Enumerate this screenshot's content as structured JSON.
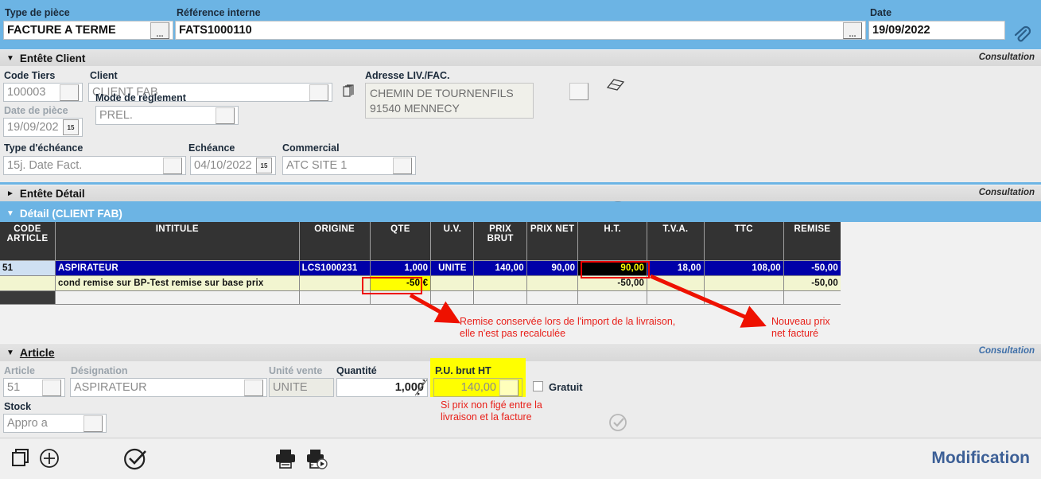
{
  "header": {
    "type_piece_label": "Type de pièce",
    "type_piece_value": "FACTURE A TERME",
    "reference_label": "Référence interne",
    "reference_value": "FATS1000110",
    "date_label": "Date",
    "date_value": "19/09/2022",
    "attach_icon": "paperclip-icon",
    "ellipsis": "..."
  },
  "entete_client": {
    "title": "Entête Client",
    "status": "Consultation",
    "code_tiers_label": "Code Tiers",
    "code_tiers_value": "100003",
    "client_label": "Client",
    "client_value": "CLIENT FAB",
    "copy_icon": "copy-pages-icon",
    "adresse_label": "Adresse LIV./FAC.",
    "adresse_line1": "CHEMIN DE TOURNENFILS",
    "adresse_line2": "91540  MENNECY",
    "map_icon": "folded-map-icon",
    "check_icon": "check-circle-icon",
    "date_piece_label": "Date de pièce",
    "date_piece_value": "19/09/202",
    "mode_reglement_label": "Mode de règlement",
    "mode_reglement_value": "PREL.",
    "type_echeance_label": "Type d'échéance",
    "type_echeance_value": "15j. Date Fact.",
    "echeance_label": "Echéance",
    "echeance_value": "04/10/2022",
    "commercial_label": "Commercial",
    "commercial_value": "ATC SITE 1",
    "cal_icon": "calendar-icon"
  },
  "entete_detail": {
    "title": "Entête Détail",
    "status": "Consultation"
  },
  "detail": {
    "title": "Détail (CLIENT FAB)",
    "columns": [
      "CODE ARTICLE",
      "INTITULE",
      "ORIGINE",
      "QTE",
      "U.V.",
      "PRIX BRUT",
      "PRIX NET",
      "H.T.",
      "T.V.A.",
      "TTC",
      "REMISE"
    ],
    "rows": [
      {
        "code": "51",
        "intitule": "ASPIRATEUR",
        "origine": "LCS1000231",
        "qte": "1,000",
        "uv": "UNITE",
        "prix_brut": "140,00",
        "prix_net": "90,00",
        "ht": "90,00",
        "tva": "18,00",
        "ttc": "108,00",
        "remise": "-50,00"
      },
      {
        "code": "",
        "intitule": "cond remise sur BP-Test remise sur base prix",
        "origine": "",
        "qte": "-50  €",
        "uv": "",
        "prix_brut": "",
        "prix_net": "",
        "ht": "-50,00",
        "tva": "",
        "ttc": "",
        "remise": "-50,00"
      },
      {
        "code": "",
        "intitule": "",
        "origine": "",
        "qte": "",
        "uv": "",
        "prix_brut": "",
        "prix_net": "",
        "ht": "",
        "tva": "",
        "ttc": "",
        "remise": ""
      }
    ]
  },
  "annotations": {
    "remise_note_line1": "Remise conservée lors de l'import de la livraison,",
    "remise_note_line2": "elle n'est pas recalculée",
    "prix_note_line1": "Nouveau prix",
    "prix_note_line2": "net facturé",
    "pu_note_line1": "Si prix non figé entre la",
    "pu_note_line2": "livraison et la facture",
    "color": "#e8201a"
  },
  "article": {
    "title": "Article",
    "status": "Consultation",
    "article_label": "Article",
    "article_value": "51",
    "designation_label": "Désignation",
    "designation_value": "ASPIRATEUR",
    "unite_vente_label": "Unité vente",
    "unite_vente_value": "UNITE",
    "quantite_label": "Quantité",
    "quantite_value": "1,000",
    "spinner_icon": "spinner-updown-icon",
    "pu_label": "P.U. brut HT",
    "pu_value": "140,00",
    "gratuit_label": "Gratuit",
    "gratuit_checked": false,
    "stock_label": "Stock",
    "stock_value": "Appro a",
    "check_icon": "check-circle-icon",
    "highlight_color": "#ffff00"
  },
  "toolbar": {
    "copy_icon": "duplicate-icon",
    "add_icon": "plus-circle-icon",
    "validate_icon": "check-circle-icon",
    "print_icon": "printer-icon",
    "print_preview_icon": "printer-preview-icon",
    "mode_label": "Modification"
  }
}
